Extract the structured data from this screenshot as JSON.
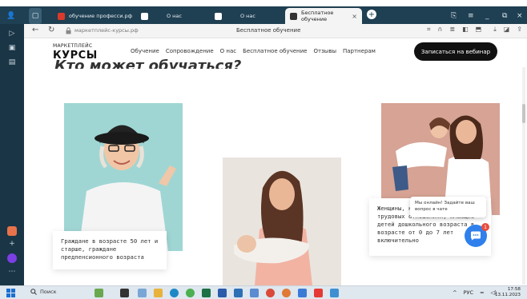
{
  "browser": {
    "tabs": [
      {
        "label": "обучение професси.рф",
        "active": false
      },
      {
        "label": "О нас",
        "active": false
      },
      {
        "label": "О нас",
        "active": false
      },
      {
        "label": "Бесплатное обучение",
        "active": true
      }
    ],
    "address": "маркетплейс-курсы.рф",
    "page_title": "Бесплатное обучение"
  },
  "site": {
    "logo_top": "МАРКЕТПЛЕЙС",
    "logo_main": "КУРСЫ",
    "menu": [
      "Обучение",
      "Сопровождение",
      "О нас",
      "Бесплатное обучение",
      "Отзывы",
      "Партнерам"
    ],
    "cta": "Записаться на вебинар",
    "heading_fragment": "Кто может обучаться?",
    "cards": [
      {
        "text": "Граждане в возрасте 50 лет и старше, граждане предпенсионного возраста"
      },
      {
        "text": "Женщины, находящиеся в трудовых отношениях, имеющие детей дошкольного возраста в возрасте от 0 до 7 лет включительно"
      }
    ],
    "chat_text": "Мы онлайн! Задайте ваш вопрос в чате",
    "chat_badge": "1"
  },
  "taskbar": {
    "search_label": "Поиск",
    "lang": "РУС",
    "time": "17:58",
    "date": "13.11.2023"
  },
  "colors": {
    "chrome": "#1f3f52",
    "cta_bg": "#111111",
    "chat": "#2f80ed",
    "badge": "#e84c3d"
  }
}
